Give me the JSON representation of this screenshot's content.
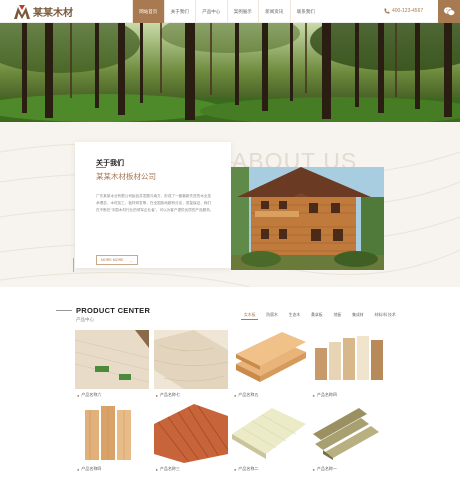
{
  "header": {
    "logo_text": "某某木材",
    "nav": [
      "网站首页",
      "关于我们",
      "产品中心",
      "案例展示",
      "新闻资讯",
      "联系我们"
    ],
    "active_index": 0,
    "phone": "400-123-4567",
    "brand_color": "#a87a52"
  },
  "about": {
    "bg_text": "ABOUT US",
    "title": "关于我们",
    "company": "某某木材板材公司",
    "paragraph": "广东某某木业有限公司始创并发展与南方，形成了一套最新先进的木业技术理念，木材加工、板材研发等，在全国各地都有分店，质量保证，我们在不断在“中国木材行业的领军企业者”，可以为客户提供优质的产品服务。",
    "more": "MORE MORE",
    "more_arrow": "→"
  },
  "product": {
    "title": "PRODUCT CENTER",
    "subtitle": "产品中心",
    "tabs": [
      "实木板",
      "防腐木",
      "生态木",
      "桑拿板",
      "地板",
      "集成材",
      "材料 科 技术"
    ],
    "active_tab": 0,
    "next_arrow": "›",
    "items": [
      {
        "label": "产品名称六"
      },
      {
        "label": "产品名称七"
      },
      {
        "label": "产品名称五"
      },
      {
        "label": "产品名称四"
      },
      {
        "label": "产品名称四"
      },
      {
        "label": "产品名称三"
      },
      {
        "label": "产品名称二"
      },
      {
        "label": "产品名称一"
      }
    ],
    "bullet": "●"
  }
}
